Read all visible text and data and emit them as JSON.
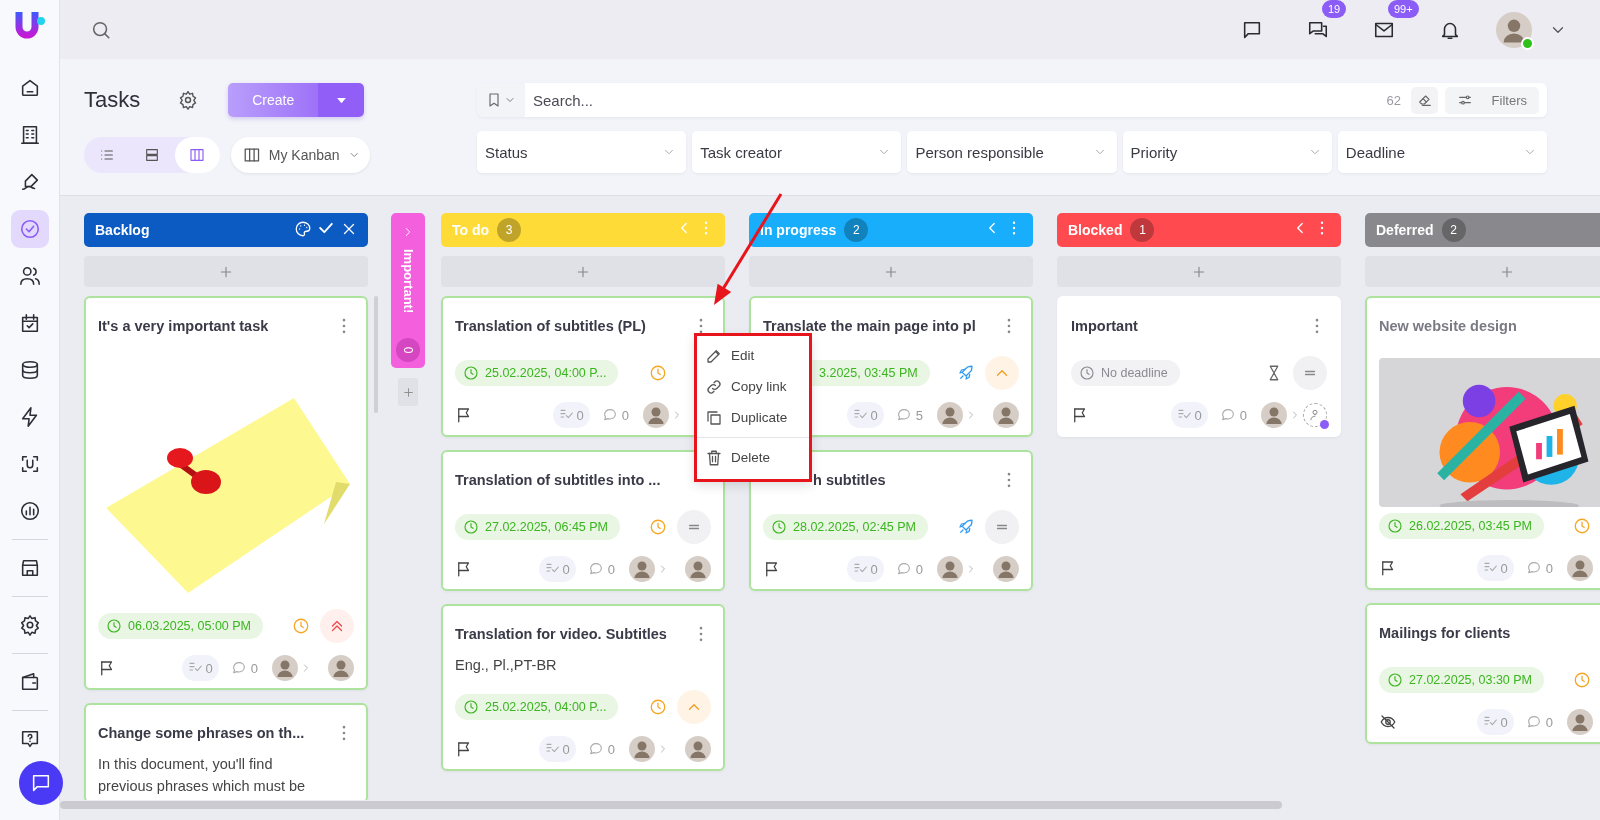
{
  "sidebar": {
    "groups": [
      [
        {
          "selected": false
        },
        {
          "selected": false
        },
        {
          "selected": false
        },
        {
          "selected": true
        },
        {
          "selected": false
        },
        {
          "selected": false
        },
        {
          "selected": false
        },
        {
          "selected": false
        },
        {
          "selected": false
        },
        {
          "selected": false
        }
      ],
      [
        {
          "selected": false
        }
      ],
      [
        {
          "selected": false
        }
      ],
      [
        {
          "selected": false
        }
      ],
      [
        {
          "selected": false
        }
      ]
    ]
  },
  "topbar": {
    "messages_badge": "19",
    "mail_badge": "99+",
    "user": {
      "online": true
    }
  },
  "page": {
    "title": "Tasks",
    "create_label": "Create",
    "views": [
      {
        "selected": false
      },
      {
        "selected": false
      },
      {
        "selected": true
      }
    ],
    "board_name": "My Kanban"
  },
  "search": {
    "placeholder": "Search...",
    "count": "62",
    "filters_label": "Filters"
  },
  "filters": [
    "Status",
    "Task creator",
    "Person responsible",
    "Priority",
    "Deadline"
  ],
  "columns": [
    {
      "kind": "full",
      "title": "Backlog",
      "color": "#0b5bc3",
      "tools": {
        "kind": "edit"
      },
      "cards": [
        {
          "title": "It's a very important task",
          "dim": false,
          "outlined": true,
          "more": true,
          "date": {
            "text": "06.03.2025, 05:00 PM",
            "kind": "deadline"
          },
          "status": {
            "kind": "clock"
          },
          "priority": {
            "kind": "high"
          },
          "marker": {
            "kind": "flag"
          },
          "checklist": "0",
          "comments": "0",
          "handoff": true
        },
        {
          "title": "Change some phrases on th...",
          "dim": false,
          "outlined": true,
          "more": true,
          "description": "In this document, you'll find previous phrases which must be"
        }
      ]
    },
    {
      "kind": "collapsed",
      "title": "Important!",
      "color": "#f35fdc",
      "count": "0"
    },
    {
      "kind": "full",
      "title": "To do",
      "color": "#ffdb37",
      "count": "3",
      "tools": {
        "kind": "nav"
      },
      "cards": [
        {
          "title": "Translation of subtitles (PL)",
          "dim": false,
          "outlined": true,
          "more": true,
          "date": {
            "text": "25.02.2025, 04:00 P...",
            "kind": "deadline"
          },
          "status": {
            "kind": "clock"
          },
          "marker": {
            "kind": "flag"
          },
          "checklist": "0",
          "comments": "0",
          "handoff": true
        },
        {
          "title": "Translation of subtitles into ...",
          "dim": false,
          "outlined": true,
          "more": false,
          "date": {
            "text": "27.02.2025, 06:45 PM",
            "kind": "deadline"
          },
          "status": {
            "kind": "clock"
          },
          "priority": {
            "kind": "normal"
          },
          "marker": {
            "kind": "flag"
          },
          "checklist": "0",
          "comments": "0",
          "handoff": true
        },
        {
          "title": "Translation for video. Subtitles",
          "dim": false,
          "outlined": true,
          "more": true,
          "description": "Eng., Pl.,PT-BR",
          "date": {
            "text": "25.02.2025, 04:00 P...",
            "kind": "deadline"
          },
          "status": {
            "kind": "clock"
          },
          "priority": {
            "kind": "up"
          },
          "marker": {
            "kind": "flag"
          },
          "checklist": "0",
          "comments": "0",
          "handoff": true
        }
      ]
    },
    {
      "kind": "full",
      "title": "In progress",
      "color": "#18aefc",
      "count": "2",
      "tools": {
        "kind": "nav"
      },
      "cards": [
        {
          "title": "Translate the main page into pl",
          "dim": false,
          "outlined": true,
          "more": true,
          "covered": {
            "kind": "date"
          },
          "date": {
            "text": "3.2025, 03:45 PM",
            "kind": "deadline"
          },
          "status": {
            "kind": "rocket"
          },
          "priority": {
            "kind": "up"
          },
          "checklist": "0",
          "comments": "5",
          "handoff": true
        },
        {
          "title": "h subtitles",
          "dim": false,
          "outlined": true,
          "more": true,
          "covered": {
            "kind": "title"
          },
          "date": {
            "text": "28.02.2025, 02:45 PM",
            "kind": "deadline"
          },
          "status": {
            "kind": "rocket"
          },
          "priority": {
            "kind": "normal"
          },
          "marker": {
            "kind": "flag"
          },
          "checklist": "0",
          "comments": "0",
          "handoff": true
        }
      ]
    },
    {
      "kind": "full",
      "title": "Blocked",
      "color": "#ff4b4f",
      "count": "1",
      "tools": {
        "kind": "nav"
      },
      "cards": [
        {
          "title": "Important",
          "dim": false,
          "outlined": false,
          "more": true,
          "date": {
            "text": "No deadline",
            "kind": "none"
          },
          "status": {
            "kind": "hourglass"
          },
          "priority": {
            "kind": "normal"
          },
          "marker": {
            "kind": "flag"
          },
          "checklist": "0",
          "comments": "0",
          "handoff": true,
          "to": {
            "kind": "add"
          }
        }
      ]
    },
    {
      "kind": "full",
      "title": "Deferred",
      "color": "#88888d",
      "count": "2",
      "cards": [
        {
          "title": "New website design",
          "dim": true,
          "outlined": true,
          "more": false,
          "date": {
            "text": "26.02.2025, 03:45 PM",
            "kind": "deadline"
          },
          "status": {
            "kind": "clock"
          },
          "marker": {
            "kind": "flag"
          },
          "checklist": "0",
          "comments": "0",
          "handoff": false
        },
        {
          "title": "Mailings for clients",
          "dim": false,
          "outlined": true,
          "more": false,
          "date": {
            "text": "27.02.2025, 03:30 PM",
            "kind": "deadline"
          },
          "status": {
            "kind": "clock"
          },
          "marker": {
            "kind": "hidden"
          },
          "checklist": "0",
          "comments": "0",
          "handoff": false
        }
      ]
    }
  ],
  "context_menu": {
    "items": [
      {
        "label": "Edit",
        "separated": false
      },
      {
        "label": "Copy link",
        "separated": false
      },
      {
        "label": "Duplicate",
        "separated": false
      },
      {
        "label": "Delete",
        "separated": true
      }
    ]
  }
}
